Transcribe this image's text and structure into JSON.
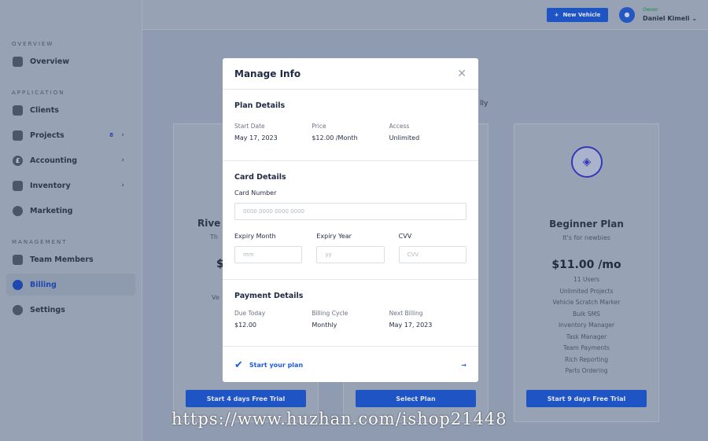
{
  "sidebar": {
    "sections": [
      {
        "title": "OVERVIEW",
        "items": [
          {
            "label": "Overview",
            "icon": "activity-icon"
          }
        ]
      },
      {
        "title": "APPLICATION",
        "items": [
          {
            "label": "Clients",
            "icon": "users-icon"
          },
          {
            "label": "Projects",
            "icon": "document-icon",
            "badge": "8"
          },
          {
            "label": "Accounting",
            "icon": "pound-icon"
          },
          {
            "label": "Inventory",
            "icon": "clipboard-icon"
          },
          {
            "label": "Marketing",
            "icon": "chat-icon"
          }
        ]
      },
      {
        "title": "MANAGEMENT",
        "items": [
          {
            "label": "Team Members",
            "icon": "team-icon"
          },
          {
            "label": "Billing",
            "icon": "billing-icon",
            "active": true
          },
          {
            "label": "Settings",
            "icon": "gear-icon"
          }
        ]
      }
    ]
  },
  "header": {
    "new_vehicle": "New Vehicle",
    "role": "Owner",
    "user": "Daniel Kimeli"
  },
  "background": {
    "toggle_text": "lly",
    "left_card": {
      "title": "Rive",
      "subtitle": "Th",
      "price": "$",
      "feature": "Ve",
      "button": "Start 4 days Free Trial"
    },
    "middle_card": {
      "button": "Select Plan"
    },
    "right_card": {
      "title": "Beginner Plan",
      "subtitle": "It's for newbies",
      "price": "$11.00 /mo",
      "features": [
        "11 Users",
        "Unlimited Projects",
        "Vehicle Scratch Marker",
        "Bulk SMS",
        "Inventory Manager",
        "Task Manager",
        "Team Payments",
        "Rich Reporting",
        "Parts Ordering"
      ],
      "button": "Start 9 days Free Trial"
    }
  },
  "modal": {
    "title": "Manage Info",
    "plan": {
      "title": "Plan Details",
      "start_label": "Start Date",
      "start": "May 17, 2023",
      "price_label": "Price",
      "price": "$12.00 /Month",
      "access_label": "Access",
      "access": "Unlimited"
    },
    "card": {
      "title": "Card Details",
      "number_label": "Card Number",
      "number_placeholder": "0000 0000 0000 0000",
      "month_label": "Expiry Month",
      "month_placeholder": "mm",
      "year_label": "Expiry Year",
      "year_placeholder": "yy",
      "cvv_label": "CVV",
      "cvv_placeholder": "CVV"
    },
    "payment": {
      "title": "Payment Details",
      "due_label": "Due Today",
      "due": "$12.00",
      "cycle_label": "Billing Cycle",
      "cycle": "Monthly",
      "next_label": "Next Billing",
      "next": "May 17, 2023"
    },
    "start_plan": "Start your plan"
  },
  "watermark": "https://www.huzhan.com/ishop21448",
  "colors": {
    "accent": "#1d5be0",
    "owner": "#16a34a"
  }
}
